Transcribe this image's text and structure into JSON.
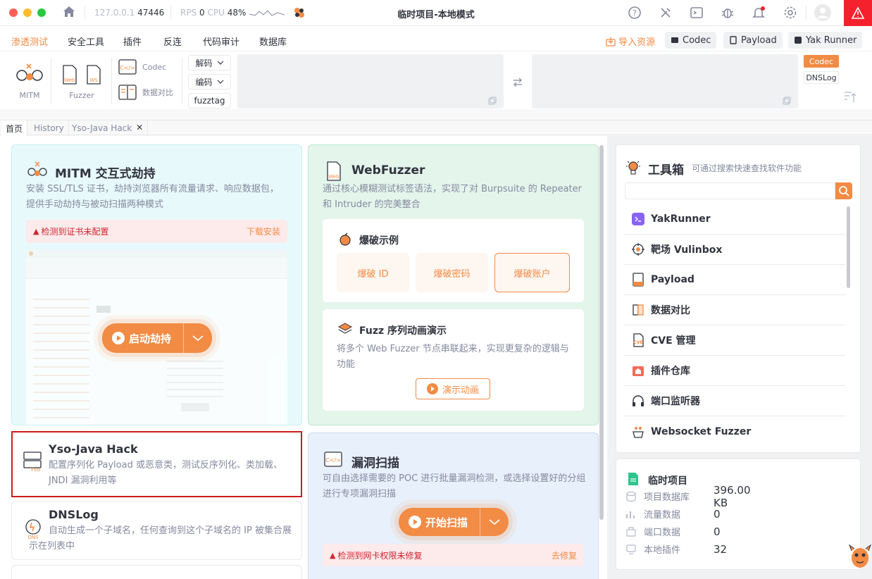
{
  "titlebar": {
    "title": "临时项目-本地模式",
    "host": "127.0.0.1",
    "port": "47446",
    "rps_label": "RPS",
    "rps_value": "0",
    "cpu_label": "CPU",
    "cpu_value": "48%"
  },
  "menu": {
    "items": [
      "渗透测试",
      "安全工具",
      "插件",
      "反连",
      "代码审计",
      "数据库"
    ],
    "import_label": "导入资源",
    "quick_buttons": [
      "Codec",
      "Payload",
      "Yak Runner"
    ]
  },
  "tools": {
    "mitm": "MITM",
    "fuzzer": "Fuzzer",
    "codec": "Codec",
    "compare": "数据对比",
    "decode": "解码",
    "encode": "编码",
    "fuzztag": "fuzztag",
    "side_codec": "Codec",
    "side_dnslog": "DNSLog"
  },
  "tabs": [
    "首页",
    "History",
    "Yso-Java Hack"
  ],
  "mitm_card": {
    "title": "MITM 交互式劫持",
    "desc": "安装 SSL/TLS 证书，劫持浏览器所有流量请求、响应数据包，提供手动劫持与被动扫描两种模式",
    "warn": "检测到证书未配置",
    "warn_action": "下载安装",
    "start_btn": "启动劫持"
  },
  "webfuzzer_card": {
    "title": "WebFuzzer",
    "desc": "通过核心模糊测试标签语法，实现了对 Burpsuite 的 Repeater 和 Intruder 的完美整合",
    "examples_title": "爆破示例",
    "examples": [
      "爆破 ID",
      "爆破密码",
      "爆破账户"
    ],
    "seq_title": "Fuzz 序列动画演示",
    "seq_desc": "将多个 Web Fuzzer 节点串联起来，实现更复杂的逻辑与功能",
    "seq_btn": "演示动画"
  },
  "yso_card": {
    "title": "Yso-Java Hack",
    "desc": "配置序列化 Payload 或恶意类，测试反序列化、类加载、JNDI 漏洞利用等"
  },
  "dnslog_card": {
    "title": "DNSLog",
    "desc": "自动生成一个子域名，任何查询到这个子域名的 IP 被集合展示在列表中"
  },
  "scan_card": {
    "title": "漏洞扫描",
    "desc": "可自由选择需要的 POC 进行批量漏洞检测，或选择设置好的分组进行专项漏洞扫描",
    "start_btn": "开始扫描",
    "warn": "检测到网卡权限未修复",
    "warn_action": "去修复"
  },
  "toolbox": {
    "title": "工具箱",
    "subtitle": "可通过搜索快速查找软件功能",
    "search_placeholder": "",
    "items": [
      "YakRunner",
      "靶场 Vulinbox",
      "Payload",
      "数据对比",
      "CVE 管理",
      "插件仓库",
      "端口监听器",
      "Websocket Fuzzer"
    ]
  },
  "project": {
    "title": "临时项目",
    "stats": [
      {
        "label": "项目数据库",
        "value": "396.00 KB"
      },
      {
        "label": "流量数据",
        "value": "0"
      },
      {
        "label": "端口数据",
        "value": "0"
      },
      {
        "label": "本地插件",
        "value": "32"
      }
    ]
  },
  "colors": {
    "accent": "#f28b44",
    "danger": "#d1242f",
    "selected_outline": "#cc1c1c"
  }
}
